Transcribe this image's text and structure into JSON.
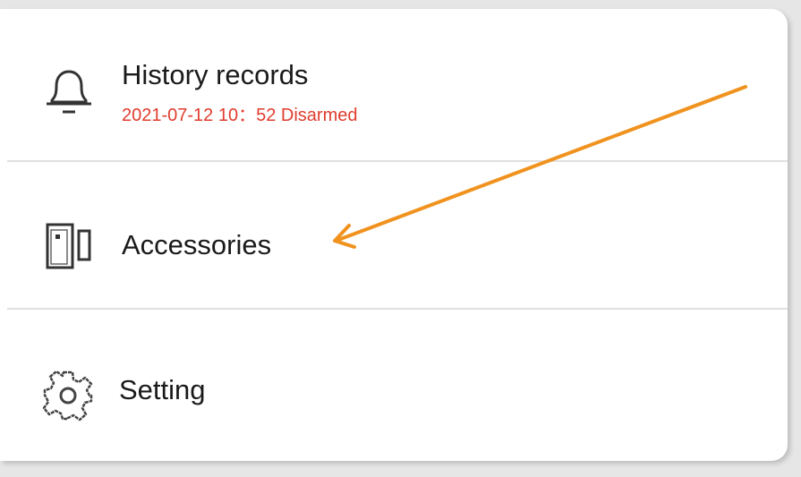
{
  "menu": {
    "items": [
      {
        "label": "History records",
        "subtitle": "2021-07-12 10：52 Disarmed",
        "icon": "bell-icon"
      },
      {
        "label": "Accessories",
        "icon": "door-sensor-icon"
      },
      {
        "label": "Setting",
        "icon": "gear-icon"
      }
    ]
  },
  "colors": {
    "subtitle": "#e03c2e",
    "annotation_arrow": "#f0921e",
    "text": "#1a1a1a",
    "divider": "#e0e0e0"
  }
}
